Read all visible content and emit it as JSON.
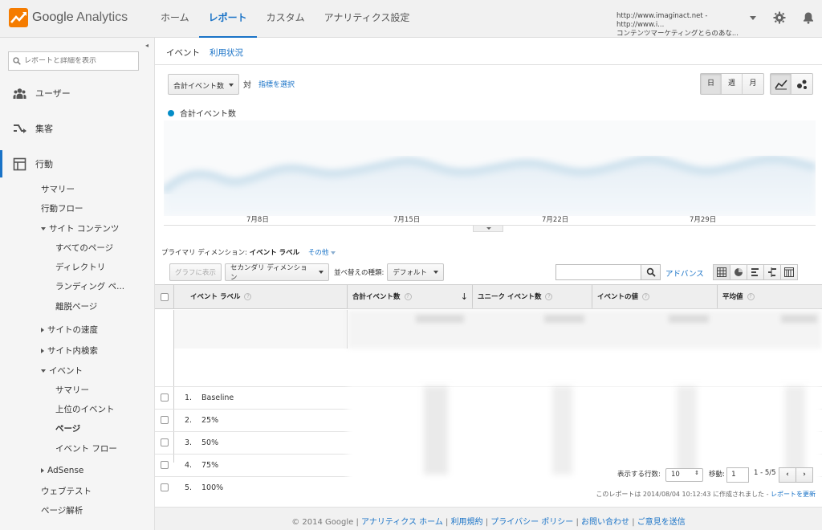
{
  "app": {
    "logo_word1": "Google",
    "logo_word2": "Analytics"
  },
  "topnav": [
    {
      "label": "ホーム",
      "active": false
    },
    {
      "label": "レポート",
      "active": true
    },
    {
      "label": "カスタム",
      "active": false
    },
    {
      "label": "アナリティクス設定",
      "active": false
    }
  ],
  "account": {
    "line1": "http://www.imaginact.net - http://www.i...",
    "line2": "コンテンツマーケティングとらのあな..."
  },
  "sidebar": {
    "search_placeholder": "レポートと詳細を表示",
    "main": [
      {
        "label": "ユーザー",
        "icon": "users-icon"
      },
      {
        "label": "集客",
        "icon": "acquisition-icon"
      },
      {
        "label": "行動",
        "icon": "behavior-icon",
        "active": true
      }
    ],
    "sub": [
      "サマリー",
      "行動フロー",
      "サイト コンテンツ",
      "すべてのページ",
      "ディレクトリ",
      "ランディング ペ...",
      "離脱ページ",
      "サイトの速度",
      "サイト内検索",
      "イベント",
      "サマリー",
      "上位のイベント",
      "ページ",
      "イベント フロー",
      "AdSense",
      "ウェブテスト",
      "ページ解析"
    ]
  },
  "subtabs": {
    "tab1": "イベント",
    "tab2": "利用状況"
  },
  "controls": {
    "metric": "合計イベント数",
    "vs": "対",
    "select_metric": "指標を選択",
    "granularity": [
      "日",
      "週",
      "月"
    ]
  },
  "chart_data": {
    "type": "area",
    "series": [
      {
        "name": "合計イベント数"
      }
    ],
    "x_ticks": [
      "7月8日",
      "7月15日",
      "7月22日",
      "7月29日"
    ],
    "color": "#058dc7"
  },
  "dimension": {
    "label": "プライマリ ディメンション:",
    "value": "イベント ラベル",
    "other": "その他"
  },
  "toolbar": {
    "plot_button": "グラフに表示",
    "secondary_dimension": "セカンダリ ディメンション",
    "sort_label": "並べ替えの種類:",
    "sort_value": "デフォルト",
    "advanced": "アドバンス"
  },
  "table": {
    "columns": [
      "イベント ラベル",
      "合計イベント数",
      "ユニーク イベント数",
      "イベントの値",
      "平均値"
    ],
    "rows": [
      {
        "num": "1.",
        "label": "Baseline"
      },
      {
        "num": "2.",
        "label": "25%"
      },
      {
        "num": "3.",
        "label": "50%"
      },
      {
        "num": "4.",
        "label": "75%"
      },
      {
        "num": "5.",
        "label": "100%"
      }
    ]
  },
  "pager": {
    "rows_label": "表示する行数:",
    "rows_value": "10",
    "goto_label": "移動:",
    "goto_value": "1",
    "range": "1 - 5/5",
    "prev": "‹",
    "next": "›"
  },
  "created": {
    "text": "このレポートは 2014/08/04 10:12:43 に作成されました - ",
    "refresh": "レポートを更新"
  },
  "footer": {
    "copyright": "© 2014 Google",
    "links": [
      "アナリティクス ホーム",
      "利用規約",
      "プライバシー ポリシー",
      "お問い合わせ",
      "ご意見を送信"
    ]
  }
}
